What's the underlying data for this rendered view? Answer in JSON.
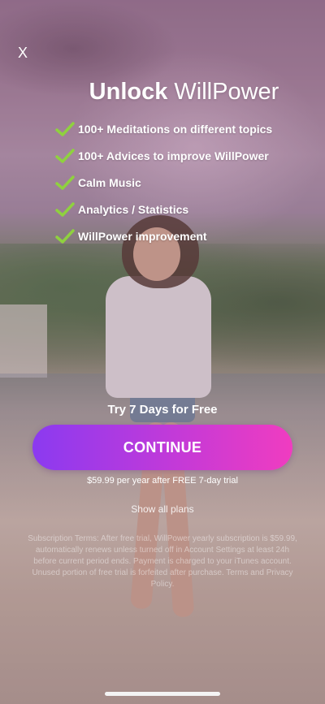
{
  "close_label": "X",
  "title": {
    "bold": "Unlock",
    "light": "WillPower"
  },
  "features": [
    "100+ Meditations on different topics",
    "100+ Advices to improve WillPower",
    "Calm Music",
    "Analytics / Statistics",
    "WillPower improvement"
  ],
  "trial_text": "Try 7 Days for Free",
  "continue_label": "CONTINUE",
  "price_text": "$59.99 per year after FREE 7-day trial",
  "show_all_plans": "Show all plans",
  "terms": "Subscription Terms: After free trial, WillPower yearly subscription is $59.99, automatically renews unless turned off in Account Settings at least 24h before current period ends. Payment is charged to your iTunes account. Unused portion of free trial is forfeited after purchase. Terms and Privacy Policy.",
  "colors": {
    "check": "#8fd13f",
    "button_start": "#8b3af0",
    "button_end": "#f03cc0"
  },
  "icons": {
    "close": "close-icon",
    "check": "check-icon"
  }
}
